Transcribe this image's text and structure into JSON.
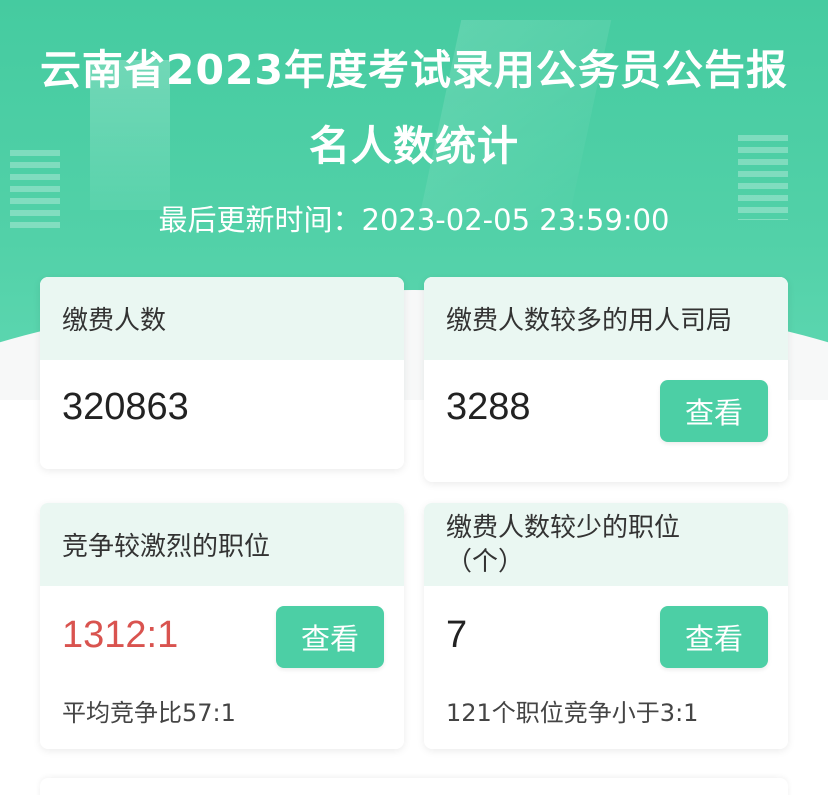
{
  "header": {
    "title": "云南省2023年度考试录用公务员公告报名人数统计",
    "updated_label": "最后更新时间：",
    "updated_time": "2023-02-05 23:59:00"
  },
  "cards": {
    "paid_count": {
      "label": "缴费人数",
      "value": "320863"
    },
    "hot_departments": {
      "label": "缴费人数较多的用人司局",
      "value": "3288",
      "button": "查看"
    },
    "competitive_positions": {
      "label": "竞争较激烈的职位",
      "value": "1312:1",
      "sub": "平均竞争比57:1",
      "button": "查看"
    },
    "few_applicant_positions": {
      "label_line1": "缴费人数较少的职位",
      "label_line2": "（个）",
      "value": "7",
      "sub": "121个职位竞争小于3:1",
      "button": "查看"
    }
  },
  "colors": {
    "accent": "#4ccfa5",
    "header_bg": "#45cba0",
    "card_head_bg": "#eaf7f2",
    "highlight_red": "#d9534f"
  }
}
